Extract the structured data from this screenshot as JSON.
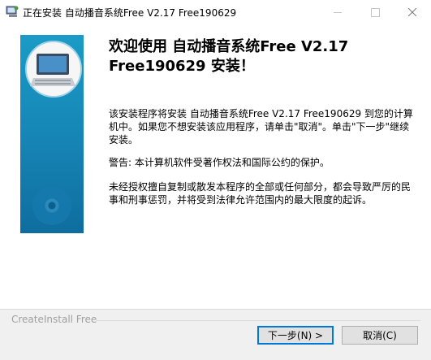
{
  "window": {
    "title": "正在安装 自动播音系统Free V2.17 Free190629"
  },
  "main": {
    "heading_line1": "欢迎使用 自动播音系统Free V2.17",
    "heading_line2": "Free190629 安装！",
    "paragraph1": "该安装程序将安装 自动播音系统Free V2.17 Free190629 到您的计算机中。如果您不想安装该应用程序，请单击\"取消\"。单击\"下一步\"继续安装。",
    "paragraph2": "警告: 本计算机软件受著作权法和国际公约的保护。",
    "paragraph3": "未经授权擅自复制或散发本程序的全部或任何部分，都会导致严厉的民事和刑事惩罚，并将受到法律允许范围内的最大限度的起诉。"
  },
  "footer": {
    "brand": "CreateInstall Free",
    "next_label": "下一步(N) >",
    "cancel_label": "取消(C)"
  },
  "colors": {
    "banner": "#1684b4",
    "accent": "#0078d7"
  }
}
